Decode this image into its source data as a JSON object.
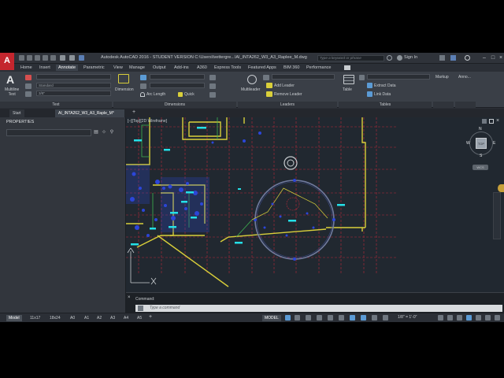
{
  "app": {
    "title": "Autodesk AutoCAD 2016 - STUDENT VERSION    C:\\Users\\lvettergre...\\AI_INTA262_W3_A3_Raplee_M.dwg",
    "search_placeholder": "Type a keyword or phrase",
    "sign_in": "Sign In",
    "logo": "A"
  },
  "ribbon_tabs": [
    "Home",
    "Insert",
    "Annotate",
    "Parametric",
    "View",
    "Manage",
    "Output",
    "Add-ins",
    "A360",
    "Express Tools",
    "Featured Apps",
    "BIM 360",
    "Performance"
  ],
  "active_ribbon_tab": "Annotate",
  "ribbon": {
    "multiline_text": "Multiline\nText",
    "text_style": "Standard",
    "text_height": "3/8\"",
    "dimension": "Dimension",
    "arc_length": "Arc Length",
    "quick": "Quick",
    "multileader": "Multileader",
    "add_leader": "Add Leader",
    "remove_leader": "Remove Leader",
    "table": "Table",
    "extract_data": "Extract Data",
    "link_data": "Link Data",
    "markup": "Markup",
    "annotation_scaling": "Anno...",
    "panels": [
      "Text",
      "Dimensions",
      "Leaders",
      "Tables"
    ]
  },
  "file_tabs": [
    "Start",
    "AI_INTA262_W3_A3_Raple_M*"
  ],
  "properties": {
    "title": "PROPERTIES"
  },
  "viewport": {
    "label": "[–][Top][2D Wireframe]",
    "viewcube_top": "TOP",
    "compass": {
      "n": "N",
      "s": "S",
      "e": "E",
      "w": "W"
    },
    "wcs": "WCS"
  },
  "command": {
    "history": "Command:",
    "placeholder": "Type a command"
  },
  "layout_tabs": [
    "Model",
    "11x17",
    "18x24",
    "A0",
    "A1",
    "A2",
    "A3",
    "A4",
    "A5"
  ],
  "active_layout_tab": "Model",
  "status": {
    "model": "MODEL",
    "scale": "1/8\" = 1'-0\""
  },
  "colors": {
    "accent_red": "#c4262e",
    "drawing_bg": "#212830",
    "grid_red": "#b8293a",
    "wall_yellow": "#d9cf3a",
    "hatch_blue": "#2c46d8",
    "text_cyan": "#24e0e8"
  }
}
